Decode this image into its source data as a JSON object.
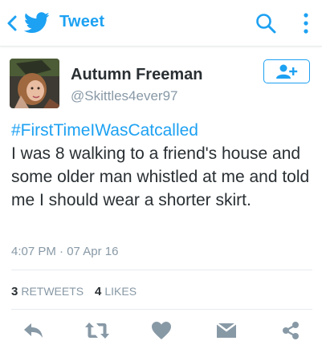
{
  "header": {
    "title": "Tweet",
    "icons": [
      "back-arrow",
      "twitter-bird",
      "search",
      "more-vertical"
    ],
    "accent_color": "#1da1f2"
  },
  "tweet": {
    "author": {
      "name": "Autumn Freeman",
      "handle": "@Skittles4ever97"
    },
    "hashtag": "#FirstTimeIWasCatcalled",
    "text": "I was 8 walking to a friend's house and some older man whistled at me and told me I should wear a shorter skirt.",
    "timestamp": "4:07 PM · 07 Apr 16",
    "retweets": {
      "count": "3",
      "label": "RETWEETS"
    },
    "likes": {
      "count": "4",
      "label": "LIKES"
    }
  },
  "actions": [
    "reply",
    "retweet",
    "like",
    "direct-message",
    "share"
  ]
}
